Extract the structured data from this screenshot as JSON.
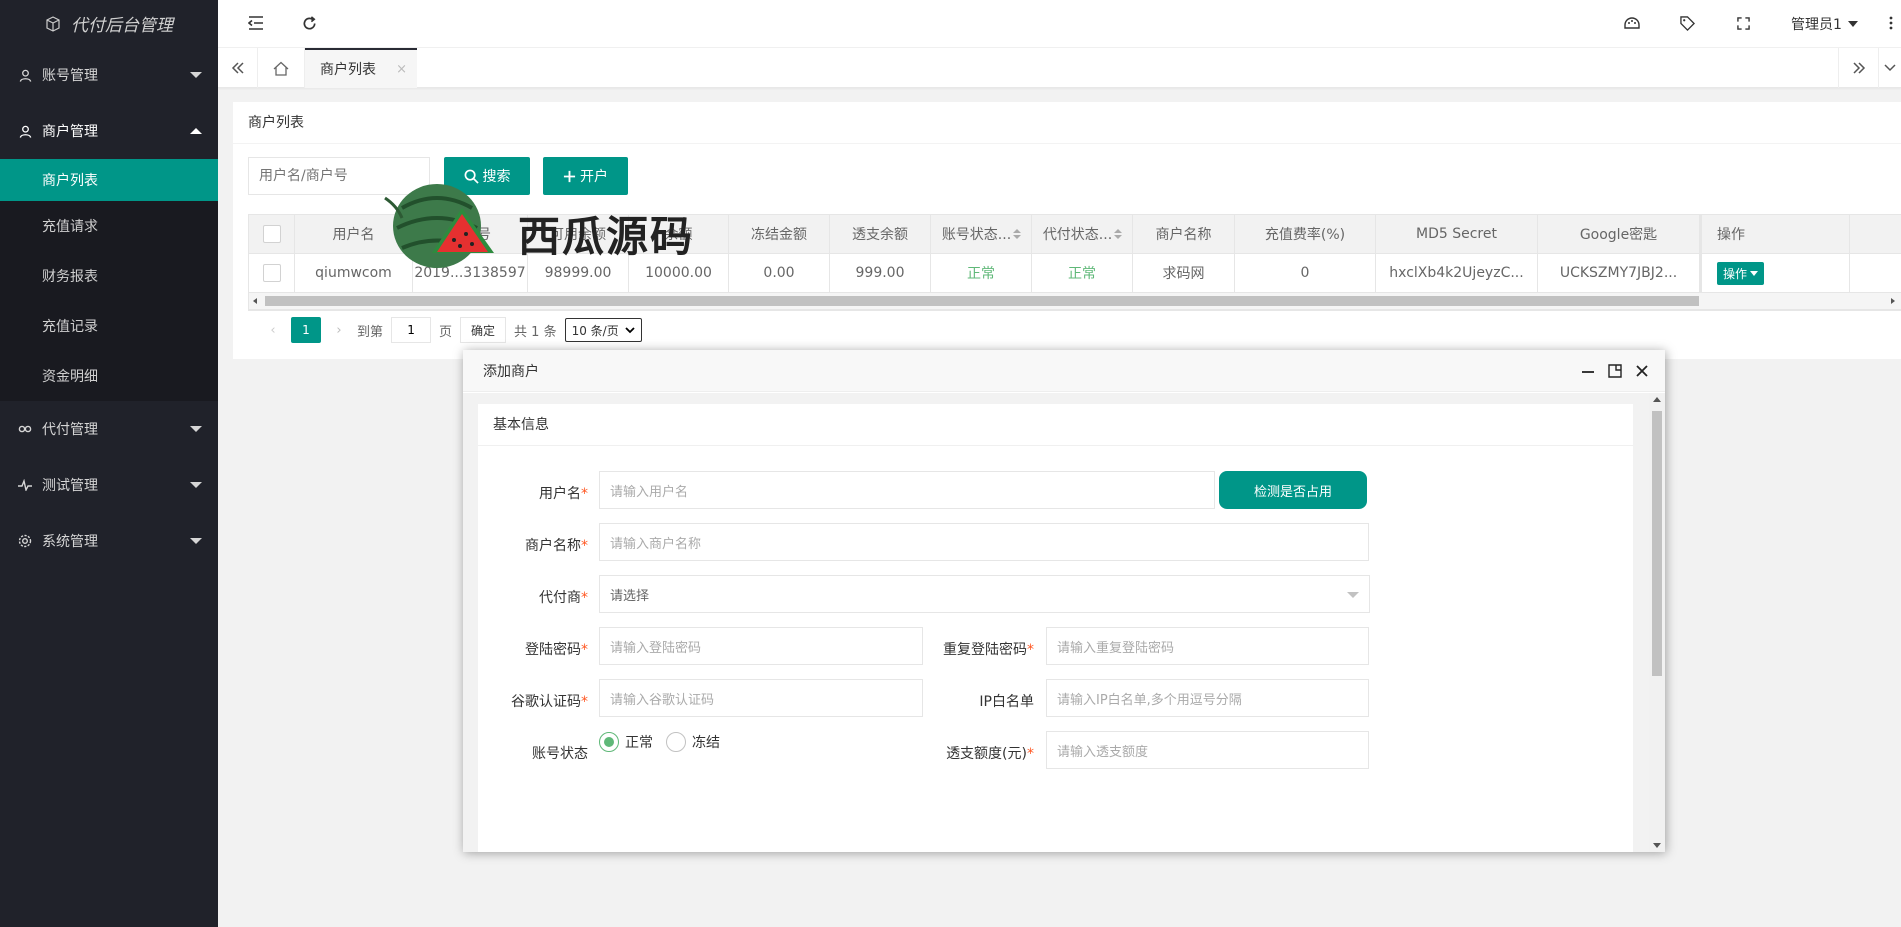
{
  "app": {
    "title": "代付后台管理"
  },
  "sidebar": {
    "groups": [
      {
        "label": "账号管理",
        "icon": "user-icon"
      },
      {
        "label": "商户管理",
        "icon": "user-icon",
        "open": true,
        "items": [
          {
            "label": "商户列表",
            "active": true
          },
          {
            "label": "充值请求"
          },
          {
            "label": "财务报表"
          },
          {
            "label": "充值记录"
          },
          {
            "label": "资金明细"
          }
        ]
      },
      {
        "label": "代付管理",
        "icon": "link-icon"
      },
      {
        "label": "测试管理",
        "icon": "pulse-icon"
      },
      {
        "label": "系统管理",
        "icon": "gear-icon"
      }
    ]
  },
  "header": {
    "admin_label": "管理员1"
  },
  "tabs": {
    "active_label": "商户列表",
    "close": "×"
  },
  "card": {
    "title": "商户列表",
    "search_placeholder": "用户名/商户号",
    "search_button": "搜索",
    "open_button": "开户"
  },
  "table": {
    "columns": [
      "用户名",
      "商户号",
      "可用余额",
      "余额",
      "冻结金额",
      "透支余额",
      "账号状态...",
      "代付状态...",
      "商户名称",
      "充值费率(%)",
      "MD5 Secret",
      "Google密匙",
      "操作"
    ],
    "rows": [
      [
        "qiumwcom",
        "2019...3138597",
        "98999.00",
        "10000.00",
        "0.00",
        "999.00",
        "正常",
        "正常",
        "求码网",
        "0",
        "hxclXb4k2UjeyzC...",
        "UCKSZMY7JBJ2...",
        "操作"
      ]
    ]
  },
  "pager": {
    "current": "1",
    "goto_label": "到第",
    "goto_value": "1",
    "page_label": "页",
    "confirm": "确定",
    "total": "共 1 条",
    "page_size": "10 条/页"
  },
  "watermark": {
    "text": "西瓜源码"
  },
  "modal": {
    "title": "添加商户",
    "section_title": "基本信息",
    "fields": {
      "username": {
        "label": "用户名",
        "placeholder": "请输入用户名"
      },
      "check_button": "检测是否占用",
      "merchant_name": {
        "label": "商户名称",
        "placeholder": "请输入商户名称"
      },
      "agent": {
        "label": "代付商",
        "placeholder": "请选择"
      },
      "password": {
        "label": "登陆密码",
        "placeholder": "请输入登陆密码"
      },
      "password_repeat": {
        "label": "重复登陆密码",
        "placeholder": "请输入重复登陆密码"
      },
      "google_code": {
        "label": "谷歌认证码",
        "placeholder": "请输入谷歌认证码"
      },
      "ip_whitelist": {
        "label": "IP白名单",
        "placeholder": "请输入IP白名单,多个用逗号分隔"
      },
      "account_status": {
        "label": "账号状态",
        "options": [
          "正常",
          "冻结"
        ],
        "selected": "正常"
      },
      "overdraft": {
        "label": "透支额度(元)",
        "placeholder": "请输入透支额度"
      }
    }
  },
  "colors": {
    "accent": "#009688",
    "sidebar": "#20222a",
    "status_ok": "#5fb878",
    "required": "#ff5722"
  }
}
